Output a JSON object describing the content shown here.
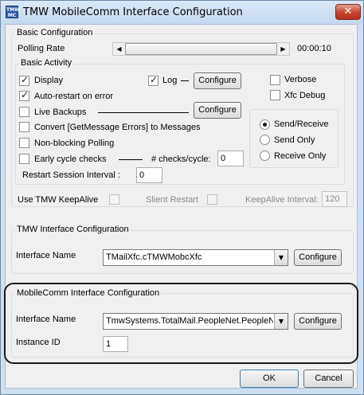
{
  "window": {
    "title": "TMW MobileComm Interface Configuration",
    "icon_text": "TMW\nMC",
    "close_glyph": "✕"
  },
  "basic_config": {
    "legend": "Basic Configuration",
    "polling_rate_label": "Polling Rate",
    "polling_rate_value": "00:00:10",
    "left_arrow": "◀",
    "right_arrow": "▶"
  },
  "basic_activity": {
    "legend": "Basic Activity",
    "display_label": "Display",
    "display_checked": true,
    "log_label": "Log",
    "log_checked": true,
    "log_configure": "Configure",
    "auto_restart_label": "Auto-restart on error",
    "auto_restart_checked": true,
    "live_backups_label": "Live Backups",
    "live_backups_configure": "Configure",
    "convert_label": "Convert [GetMessage Errors] to Messages",
    "nonblocking_label": "Non-blocking Polling",
    "early_cycle_label": "Early cycle checks",
    "checks_per_cycle_label": "# checks/cycle:",
    "checks_per_cycle_value": "0",
    "restart_interval_label": "Restart Session Interval :",
    "restart_interval_value": "0",
    "verbose_label": "Verbose",
    "xfc_debug_label": "Xfc Debug",
    "mode_options": [
      "Send/Receive",
      "Send Only",
      "Receive Only"
    ],
    "mode_selected": "Send/Receive"
  },
  "keepalive": {
    "use_label": "Use TMW KeepAlive",
    "silent_label": "Slient Restart",
    "interval_label": "KeepAlive Interval:",
    "interval_value": "120"
  },
  "tmw_interface": {
    "legend": "TMW Interface Configuration",
    "name_label": "Interface Name",
    "name_value": "TMailXfc.cTMWMobcXfc",
    "configure": "Configure"
  },
  "mobilecomm_interface": {
    "legend": "MobileComm Interface Configuration",
    "name_label": "Interface Name",
    "name_value": "TmwSystems.TotalMail.PeopleNet.PeopleNet",
    "configure": "Configure",
    "instance_label": "Instance ID",
    "instance_value": "1"
  },
  "buttons": {
    "ok": "OK",
    "cancel": "Cancel"
  },
  "icons": {
    "dropdown": "▼",
    "check": "✓"
  }
}
